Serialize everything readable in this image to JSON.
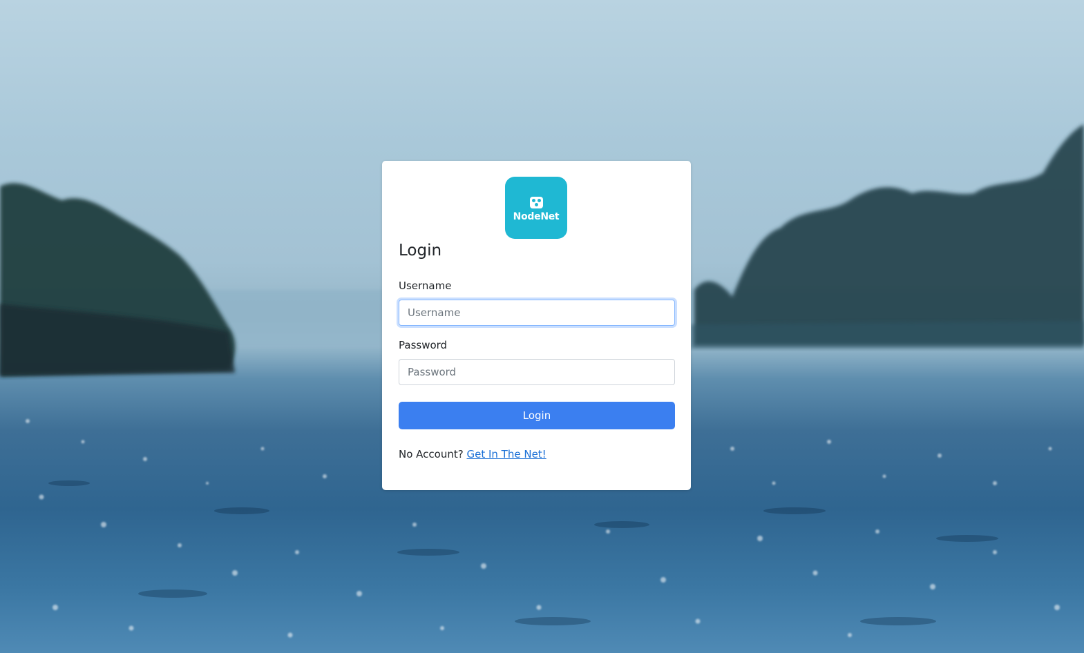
{
  "brand": {
    "logo_text": "NodeNet",
    "color": "#1fb8d3"
  },
  "login": {
    "title": "Login",
    "username": {
      "label": "Username",
      "placeholder": "Username",
      "value": ""
    },
    "password": {
      "label": "Password",
      "placeholder": "Password",
      "value": ""
    },
    "submit_label": "Login",
    "submit_color": "#3b7ff0",
    "no_account_text": "No Account?",
    "signup_link": "Get In The Net!"
  },
  "background": {
    "scene": "rainy-lake-background"
  }
}
